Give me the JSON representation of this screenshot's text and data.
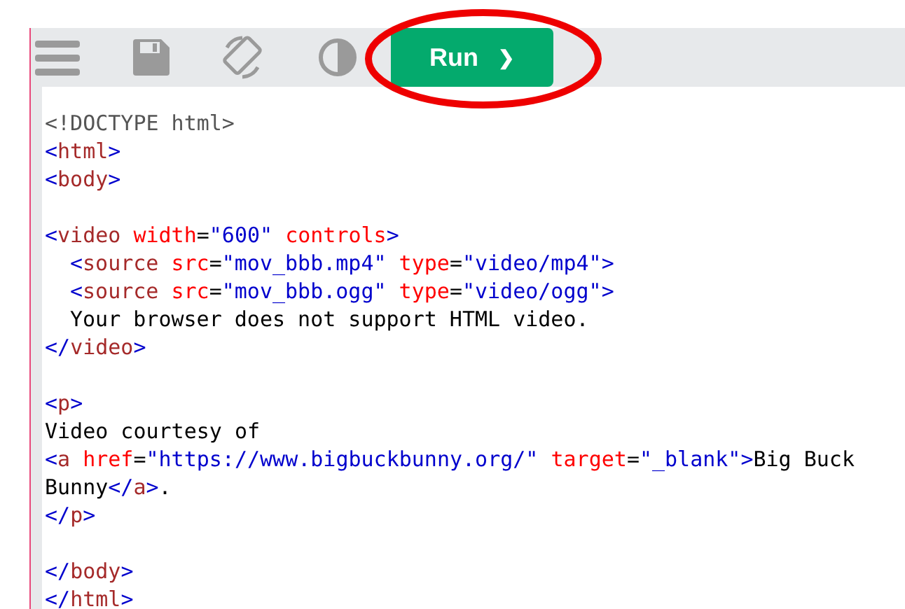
{
  "toolbar": {
    "run_button": {
      "label": "Run",
      "caret": "❯"
    }
  },
  "editor": {
    "lines": [
      {
        "kind": "code",
        "tokens": [
          {
            "kind": "doctype",
            "text": "<!DOCTYPE html>"
          }
        ]
      },
      {
        "kind": "code",
        "tokens": [
          {
            "kind": "punct",
            "text": "<"
          },
          {
            "kind": "tag",
            "text": "html"
          },
          {
            "kind": "punct",
            "text": ">"
          }
        ]
      },
      {
        "kind": "code",
        "tokens": [
          {
            "kind": "punct",
            "text": "<"
          },
          {
            "kind": "tag",
            "text": "body"
          },
          {
            "kind": "punct",
            "text": ">"
          }
        ]
      },
      {
        "kind": "blank"
      },
      {
        "kind": "code",
        "tokens": [
          {
            "kind": "punct",
            "text": "<"
          },
          {
            "kind": "tag",
            "text": "video"
          },
          {
            "kind": "attr",
            "text": " width"
          },
          {
            "kind": "text",
            "text": "="
          },
          {
            "kind": "value",
            "text": "\"600\""
          },
          {
            "kind": "attr",
            "text": " controls"
          },
          {
            "kind": "punct",
            "text": ">"
          }
        ]
      },
      {
        "kind": "code",
        "indented": true,
        "tokens": [
          {
            "kind": "punct",
            "text": "<"
          },
          {
            "kind": "tag",
            "text": "source"
          },
          {
            "kind": "attr",
            "text": " src"
          },
          {
            "kind": "text",
            "text": "="
          },
          {
            "kind": "value",
            "text": "\"mov_bbb.mp4\""
          },
          {
            "kind": "attr",
            "text": " type"
          },
          {
            "kind": "text",
            "text": "="
          },
          {
            "kind": "value",
            "text": "\"video/mp4\""
          },
          {
            "kind": "punct",
            "text": ">"
          }
        ]
      },
      {
        "kind": "code",
        "indented": true,
        "tokens": [
          {
            "kind": "punct",
            "text": "<"
          },
          {
            "kind": "tag",
            "text": "source"
          },
          {
            "kind": "attr",
            "text": " src"
          },
          {
            "kind": "text",
            "text": "="
          },
          {
            "kind": "value",
            "text": "\"mov_bbb.ogg\""
          },
          {
            "kind": "attr",
            "text": " type"
          },
          {
            "kind": "text",
            "text": "="
          },
          {
            "kind": "value",
            "text": "\"video/ogg\""
          },
          {
            "kind": "punct",
            "text": ">"
          }
        ]
      },
      {
        "kind": "code",
        "indented": true,
        "tokens": [
          {
            "kind": "text",
            "text": "Your browser does not support HTML video."
          }
        ]
      },
      {
        "kind": "code",
        "tokens": [
          {
            "kind": "punct",
            "text": "</"
          },
          {
            "kind": "tag",
            "text": "video"
          },
          {
            "kind": "punct",
            "text": ">"
          }
        ]
      },
      {
        "kind": "blank"
      },
      {
        "kind": "code",
        "tokens": [
          {
            "kind": "punct",
            "text": "<"
          },
          {
            "kind": "tag",
            "text": "p"
          },
          {
            "kind": "punct",
            "text": ">"
          }
        ]
      },
      {
        "kind": "code",
        "tokens": [
          {
            "kind": "text",
            "text": "Video courtesy of"
          }
        ]
      },
      {
        "kind": "code",
        "tokens": [
          {
            "kind": "punct",
            "text": "<"
          },
          {
            "kind": "tag",
            "text": "a"
          },
          {
            "kind": "attr",
            "text": " href"
          },
          {
            "kind": "text",
            "text": "="
          },
          {
            "kind": "value",
            "text": "\"https://www.bigbuckbunny.org/\""
          },
          {
            "kind": "attr",
            "text": " target"
          },
          {
            "kind": "text",
            "text": "="
          },
          {
            "kind": "value",
            "text": "\"_blank\""
          },
          {
            "kind": "punct",
            "text": ">"
          },
          {
            "kind": "text",
            "text": "Big Buck"
          }
        ]
      },
      {
        "kind": "code",
        "tokens": [
          {
            "kind": "text",
            "text": "Bunny"
          },
          {
            "kind": "punct",
            "text": "</"
          },
          {
            "kind": "tag",
            "text": "a"
          },
          {
            "kind": "punct",
            "text": ">"
          },
          {
            "kind": "text",
            "text": "."
          }
        ]
      },
      {
        "kind": "code",
        "tokens": [
          {
            "kind": "punct",
            "text": "</"
          },
          {
            "kind": "tag",
            "text": "p"
          },
          {
            "kind": "punct",
            "text": ">"
          }
        ]
      },
      {
        "kind": "blank"
      },
      {
        "kind": "code",
        "tokens": [
          {
            "kind": "punct",
            "text": "</"
          },
          {
            "kind": "tag",
            "text": "body"
          },
          {
            "kind": "punct",
            "text": ">"
          }
        ]
      },
      {
        "kind": "code",
        "tokens": [
          {
            "kind": "punct",
            "text": "</"
          },
          {
            "kind": "tag",
            "text": "html"
          },
          {
            "kind": "punct",
            "text": ">"
          }
        ]
      }
    ]
  }
}
